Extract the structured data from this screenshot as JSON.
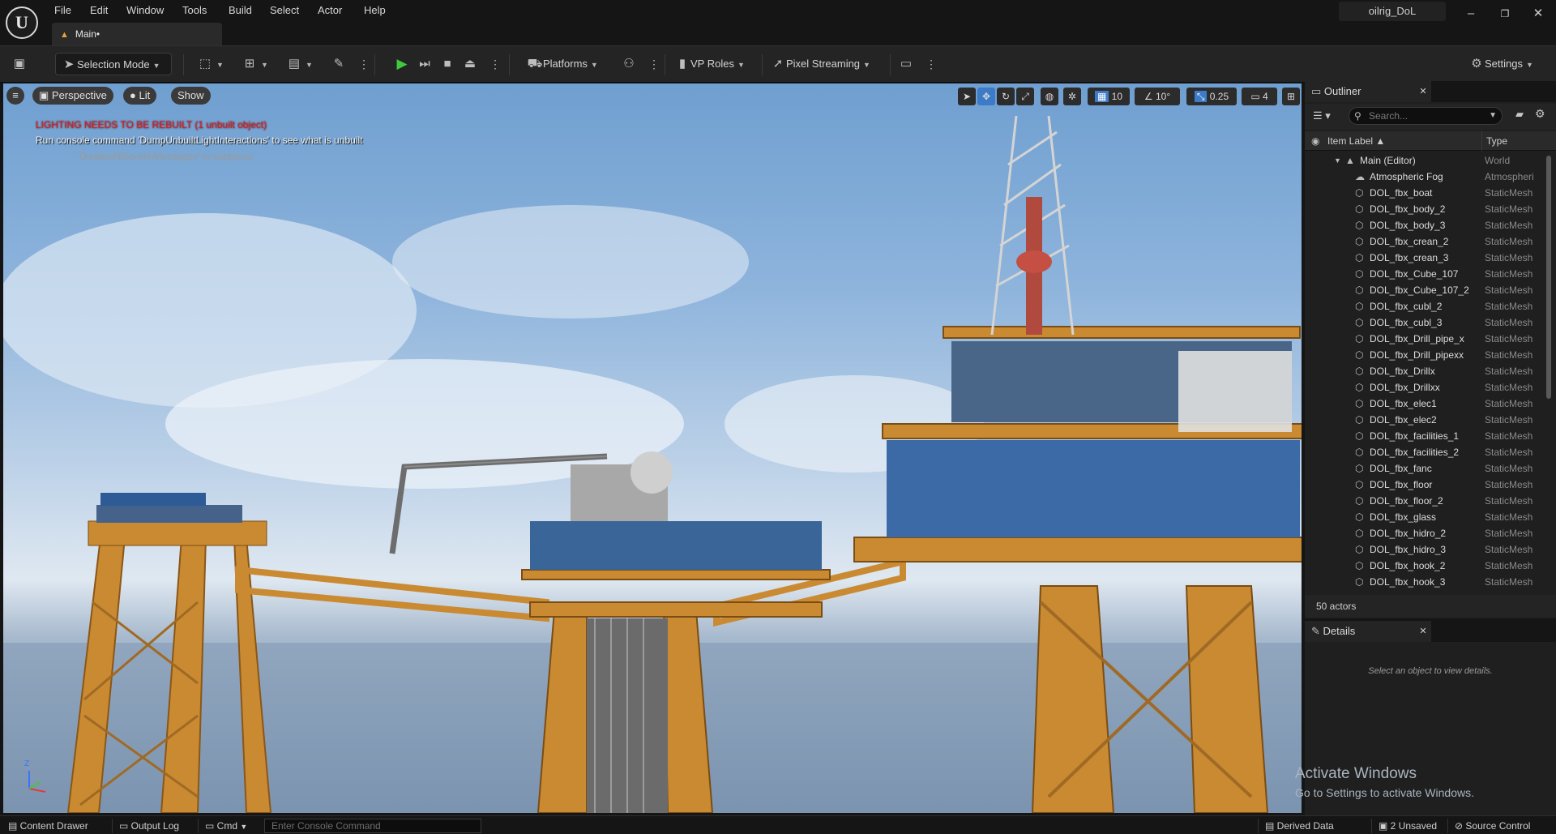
{
  "window": {
    "logo_text": "U",
    "menus": [
      "File",
      "Edit",
      "Window",
      "Tools",
      "Build",
      "Select",
      "Actor",
      "Help"
    ],
    "doc_tab": "Main•",
    "project_name": "oilrig_DoL",
    "controls": {
      "minimize": "–",
      "restore": "❐",
      "close": "✕"
    }
  },
  "toolbar": {
    "selection_mode": "Selection Mode",
    "platforms": "Platforms",
    "vp_roles": "VP Roles",
    "pixel_streaming": "Pixel Streaming",
    "settings": "Settings"
  },
  "viewport": {
    "menu_icon": "hamburger-icon",
    "perspective": "Perspective",
    "lit": "Lit",
    "show": "Show",
    "grid_snap": "10",
    "rotation_snap": "10°",
    "scale_snap": "0.25",
    "camera_speed": "4",
    "warning_title": "LIGHTING NEEDS TO BE REBUILT (1 unbuilt object)",
    "warning_body": "Run console command 'DumpUnbuiltLightInteractions' to see what is unbuilt",
    "warning_hint": "'DisableAllScreenMessages' to suppress",
    "activate_title": "Activate Windows",
    "activate_body": "Go to Settings to activate Windows.",
    "axis_label": "Z"
  },
  "outliner": {
    "title": "Outliner",
    "search_placeholder": "Search...",
    "col_label": "Item Label ▲",
    "col_type": "Type",
    "world_row": {
      "label": "Main (Editor)",
      "type": "World"
    },
    "rows": [
      {
        "label": "Atmospheric Fog",
        "type": "Atmospheri"
      },
      {
        "label": "DOL_fbx_boat",
        "type": "StaticMesh"
      },
      {
        "label": "DOL_fbx_body_2",
        "type": "StaticMesh"
      },
      {
        "label": "DOL_fbx_body_3",
        "type": "StaticMesh"
      },
      {
        "label": "DOL_fbx_crean_2",
        "type": "StaticMesh"
      },
      {
        "label": "DOL_fbx_crean_3",
        "type": "StaticMesh"
      },
      {
        "label": "DOL_fbx_Cube_107",
        "type": "StaticMesh"
      },
      {
        "label": "DOL_fbx_Cube_107_2",
        "type": "StaticMesh"
      },
      {
        "label": "DOL_fbx_cubl_2",
        "type": "StaticMesh"
      },
      {
        "label": "DOL_fbx_cubl_3",
        "type": "StaticMesh"
      },
      {
        "label": "DOL_fbx_Drill_pipe_x",
        "type": "StaticMesh"
      },
      {
        "label": "DOL_fbx_Drill_pipexx",
        "type": "StaticMesh"
      },
      {
        "label": "DOL_fbx_Drillx",
        "type": "StaticMesh"
      },
      {
        "label": "DOL_fbx_Drillxx",
        "type": "StaticMesh"
      },
      {
        "label": "DOL_fbx_elec1",
        "type": "StaticMesh"
      },
      {
        "label": "DOL_fbx_elec2",
        "type": "StaticMesh"
      },
      {
        "label": "DOL_fbx_facilities_1",
        "type": "StaticMesh"
      },
      {
        "label": "DOL_fbx_facilities_2",
        "type": "StaticMesh"
      },
      {
        "label": "DOL_fbx_fanc",
        "type": "StaticMesh"
      },
      {
        "label": "DOL_fbx_floor",
        "type": "StaticMesh"
      },
      {
        "label": "DOL_fbx_floor_2",
        "type": "StaticMesh"
      },
      {
        "label": "DOL_fbx_glass",
        "type": "StaticMesh"
      },
      {
        "label": "DOL_fbx_hidro_2",
        "type": "StaticMesh"
      },
      {
        "label": "DOL_fbx_hidro_3",
        "type": "StaticMesh"
      },
      {
        "label": "DOL_fbx_hook_2",
        "type": "StaticMesh"
      },
      {
        "label": "DOL_fbx_hook_3",
        "type": "StaticMesh"
      }
    ],
    "actor_count": "50 actors"
  },
  "details": {
    "title": "Details",
    "empty_text": "Select an object to view details."
  },
  "statusbar": {
    "content_drawer": "Content Drawer",
    "output_log": "Output Log",
    "cmd": "Cmd",
    "console_placeholder": "Enter Console Command",
    "derived_data": "Derived Data",
    "unsaved": "2 Unsaved",
    "source_control": "Source Control"
  }
}
